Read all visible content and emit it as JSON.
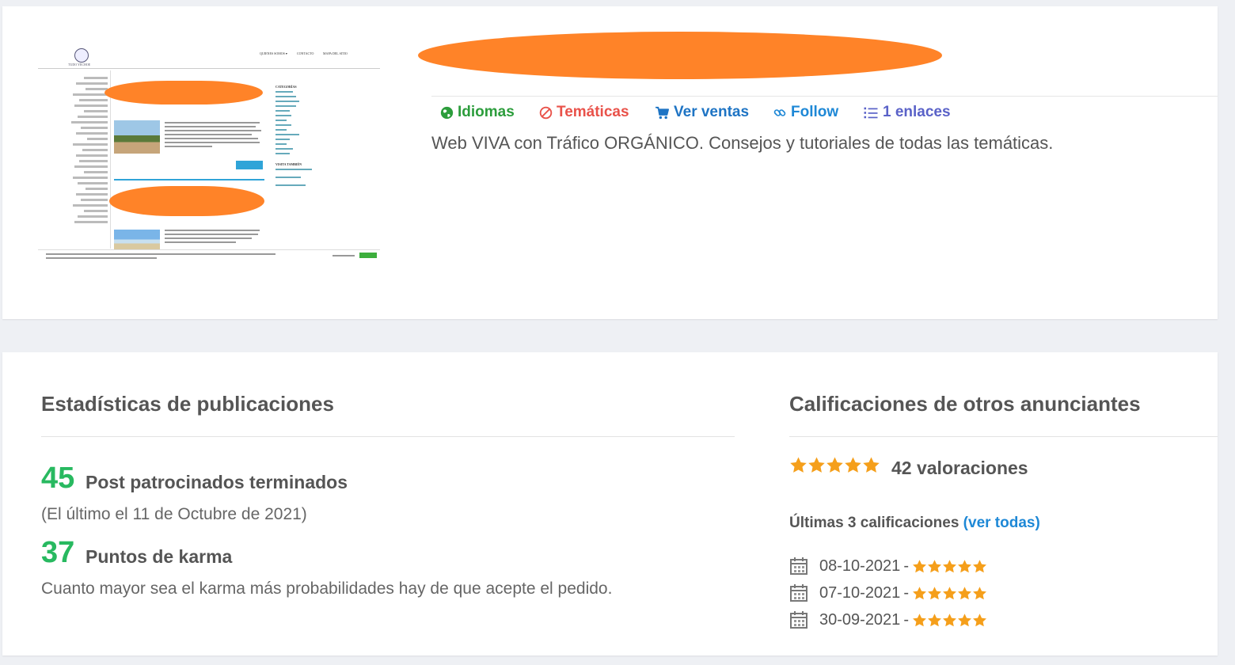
{
  "listing": {
    "thumbnail": {
      "logo_text": "TUDO YECHOE",
      "nav": [
        "QUIENES SOMOS ▾",
        "CONTACTO",
        "MAPA DEL SITIO"
      ],
      "sidebar_heading_1": "CATEGORÍAS",
      "sidebar_heading_2": "VISITA TAMBIÉN"
    },
    "links": {
      "languages": "Idiomas",
      "topics": "Temáticas",
      "sales": "Ver ventas",
      "follow": "Follow",
      "links_count": "1 enlaces"
    },
    "description": "Web VIVA con Tráfico ORGÁNICO. Consejos y tutoriales de todas las temáticas."
  },
  "stats": {
    "heading": "Estadísticas de publicaciones",
    "posts_count": "45",
    "posts_label": "Post patrocinados terminados",
    "last_post_note": "(El último el 11 de Octubre de 2021)",
    "karma_count": "37",
    "karma_label": "Puntos de karma",
    "karma_note": "Cuanto mayor sea el karma más probabilidades hay de que acepte el pedido."
  },
  "ratings": {
    "heading": "Calificaciones de otros anunciantes",
    "overall_stars": 5,
    "count_label": "42 valoraciones",
    "last_label": "Últimas 3 calificaciones",
    "see_all": "(ver todas)",
    "recent": [
      {
        "date": "08-10-2021",
        "stars": 5
      },
      {
        "date": "07-10-2021",
        "stars": 5
      },
      {
        "date": "30-09-2021",
        "stars": 5
      }
    ]
  },
  "colors": {
    "accent_green": "#28b960",
    "languages": "#2c9d3c",
    "topics": "#e9524a",
    "sales": "#1e74c4",
    "follow": "#1e88d6",
    "links": "#5a62c8",
    "star": "#f59f1b",
    "redaction": "#ff8328"
  },
  "icons": {
    "languages": "globe-icon",
    "topics": "ban-icon",
    "sales": "cart-icon",
    "follow": "link-icon",
    "links": "list-icon",
    "date": "calendar-icon",
    "rating": "star-icon"
  }
}
